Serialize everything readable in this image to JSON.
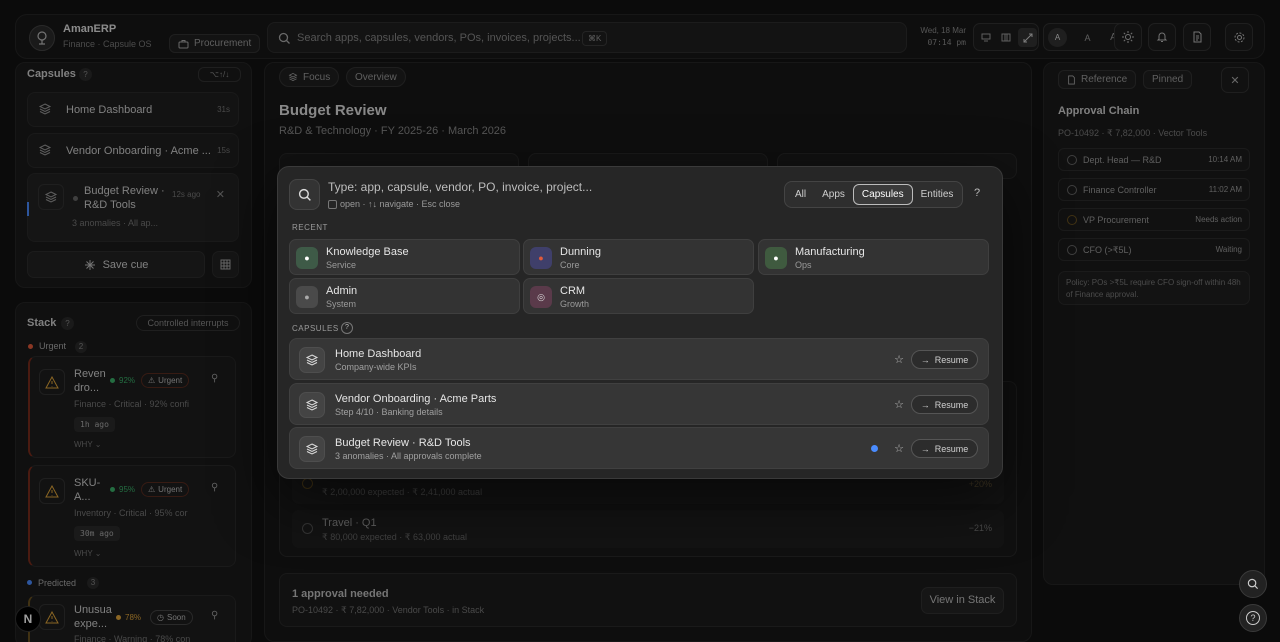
{
  "app": {
    "name": "AmanERP",
    "subtitle": "Finance · Capsule OS",
    "module": "Procurement"
  },
  "search": {
    "placeholder": "Search apps, capsules, vendors, POs, invoices, projects...",
    "shortcut": "⌘K"
  },
  "clock": {
    "date": "Wed, 18 Mar",
    "time": "07:14 pm"
  },
  "font_sizes": [
    "A",
    "A",
    "A"
  ],
  "left": {
    "capsules_title": "Capsules",
    "capsules_help": "?",
    "capsules_shortcut": "⌥↑/↓",
    "items": [
      {
        "label": "Home Dashboard",
        "age": "31s"
      },
      {
        "label": "Vendor Onboarding · Acme ...",
        "age": "15s"
      },
      {
        "label": "Budget Review · R&D Tools",
        "age": "12s ago",
        "sub": "3 anomalies · All ap..."
      }
    ],
    "save_cue": "Save cue",
    "stack_title": "Stack",
    "stack_help": "?",
    "stack_badge": "Controlled interrupts",
    "urgent_label": "Urgent",
    "urgent_count": "2",
    "urgent_items": [
      {
        "title": "Reven dro...",
        "conf": "92%",
        "tag": "Urgent",
        "meta": "Finance · Critical · 92% confi",
        "ago": "1h ago",
        "why": "WHY"
      },
      {
        "title": "SKU-A...",
        "conf": "95%",
        "tag": "Urgent",
        "meta": "Inventory · Critical · 95% cor",
        "ago": "30m ago",
        "why": "WHY"
      }
    ],
    "predicted_label": "Predicted",
    "predicted_count": "3",
    "predicted_items": [
      {
        "title": "Unusua expe...",
        "conf": "78%",
        "tag": "Soon",
        "meta": "Finance · Warning · 78% con"
      }
    ]
  },
  "main": {
    "chips": [
      "Focus",
      "Overview"
    ],
    "title": "Budget Review",
    "subtitle": "R&D & Technology · FY 2025-26 · March 2026",
    "variances": [
      {
        "label": "",
        "sub": "₹ 2,00,000 expected · ₹ 2,41,000 actual",
        "pct": "+20%"
      },
      {
        "label": "Travel · Q1",
        "sub": "₹ 80,000 expected · ₹ 63,000 actual",
        "pct": "−21%"
      }
    ],
    "approval_title": "1 approval needed",
    "approval_sub": "PO-10492 · ₹ 7,82,000 · Vendor Tools · in Stack",
    "view_stack": "View in Stack"
  },
  "right": {
    "chips": [
      "Reference",
      "Pinned"
    ],
    "title": "Approval Chain",
    "sub": "PO-10492 · ₹ 7,82,000 · Vector Tools",
    "steps": [
      {
        "label": "Dept. Head — R&D",
        "status": "10:14 AM"
      },
      {
        "label": "Finance Controller",
        "status": "11:02 AM"
      },
      {
        "label": "VP Procurement",
        "status": "Needs action"
      },
      {
        "label": "CFO (>₹5L)",
        "status": "Waiting"
      }
    ],
    "policy": "Policy: POs >₹5L require CFO sign-off within 48h of Finance approval."
  },
  "palette": {
    "placeholder": "Type: app, capsule, vendor, PO, invoice, project...",
    "hint": "open · ↑↓ navigate · Esc close",
    "filters": [
      "All",
      "Apps",
      "Capsules",
      "Entities"
    ],
    "active_filter": "Capsules",
    "help": "?",
    "recent_label": "RECENT",
    "recent": [
      {
        "title": "Knowledge Base",
        "sub": "Service",
        "color": "#3e5a47"
      },
      {
        "title": "Dunning",
        "sub": "Core",
        "color": "#3f3f6a"
      },
      {
        "title": "Manufacturing",
        "sub": "Ops",
        "color": "#3f5a3f"
      },
      {
        "title": "Admin",
        "sub": "System",
        "color": "#4a4a4a"
      },
      {
        "title": "CRM",
        "sub": "Growth",
        "color": "#5a3a4a"
      }
    ],
    "capsules_label": "CAPSULES",
    "capsules_help": "?",
    "capsules": [
      {
        "title": "Home Dashboard",
        "sub": "Company-wide KPIs",
        "action": "Resume"
      },
      {
        "title": "Vendor Onboarding · Acme Parts",
        "sub": "Step 4/10 · Banking details",
        "action": "Resume"
      },
      {
        "title": "Budget Review · R&D Tools",
        "sub": "3 anomalies · All approvals complete",
        "action": "Resume"
      }
    ]
  },
  "colors": {
    "accent": "#4a8cff",
    "urgent": "#e05a3a",
    "warn": "#e0a53a",
    "ok": "#3ab06a"
  }
}
